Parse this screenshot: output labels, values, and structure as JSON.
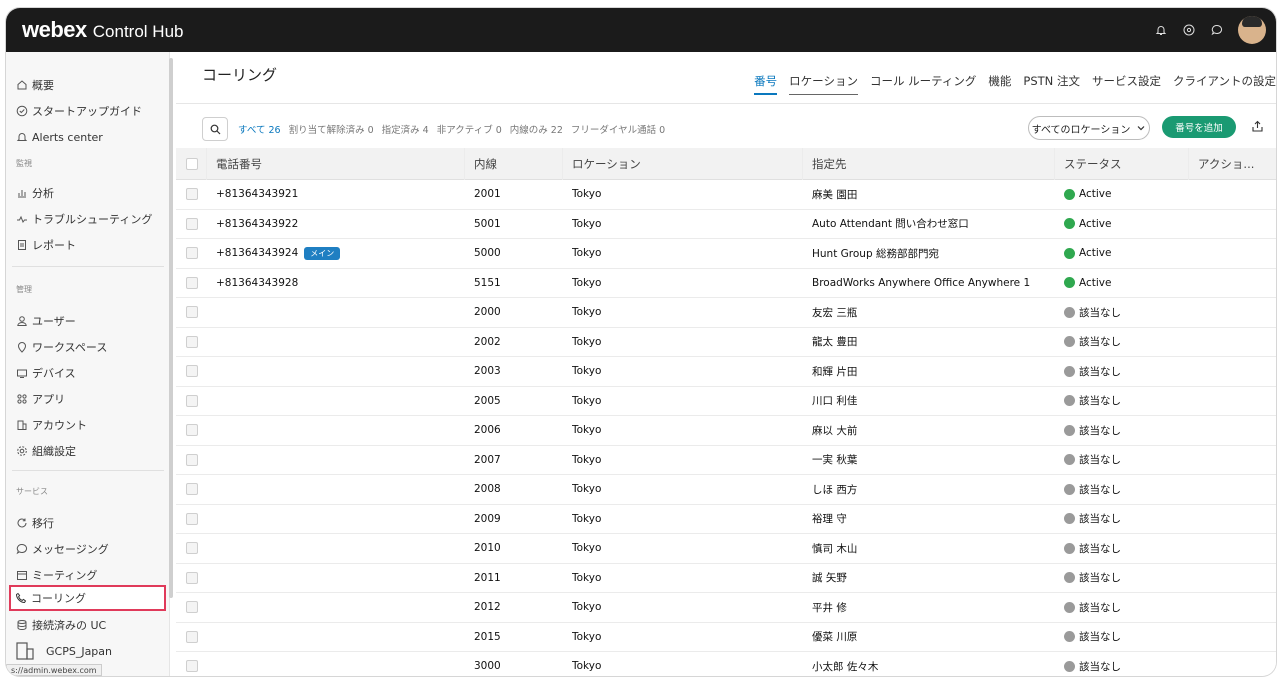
{
  "app": {
    "logo": "webex",
    "product": "Control Hub"
  },
  "sidebar": {
    "items_top": [
      {
        "label": "概要",
        "icon": "home-icon"
      },
      {
        "label": "スタートアップガイド",
        "icon": "check-circle-icon"
      },
      {
        "label": "Alerts center",
        "icon": "bell-icon"
      }
    ],
    "section_monitor": "監視",
    "items_monitor": [
      {
        "label": "分析",
        "icon": "bar-chart-icon"
      },
      {
        "label": "トラブルシューティング",
        "icon": "pulse-icon"
      },
      {
        "label": "レポート",
        "icon": "report-icon"
      }
    ],
    "section_manage": "管理",
    "items_manage": [
      {
        "label": "ユーザー",
        "icon": "user-icon"
      },
      {
        "label": "ワークスペース",
        "icon": "location-pin-icon"
      },
      {
        "label": "デバイス",
        "icon": "device-icon"
      },
      {
        "label": "アプリ",
        "icon": "apps-icon"
      },
      {
        "label": "アカウント",
        "icon": "building-icon"
      },
      {
        "label": "組織設定",
        "icon": "gear-icon"
      }
    ],
    "section_services": "サービス",
    "items_services": [
      {
        "label": "移行",
        "icon": "refresh-icon"
      },
      {
        "label": "メッセージング",
        "icon": "chat-icon"
      },
      {
        "label": "ミーティング",
        "icon": "calendar-icon"
      },
      {
        "label": "コーリング",
        "icon": "phone-icon"
      },
      {
        "label": "接続済みの UC",
        "icon": "database-icon"
      }
    ],
    "org_name": "GCPS_Japan",
    "status_url": "s://admin.webex.com"
  },
  "page": {
    "title": "コーリング",
    "tabs": [
      "番号",
      "ロケーション",
      "コール ルーティング",
      "機能",
      "PSTN 注文",
      "サービス設定",
      "クライアントの設定"
    ],
    "active_tab": "番号"
  },
  "filters": [
    {
      "label": "すべて 26",
      "active": true
    },
    {
      "label": "割り当て解除済み 0",
      "active": false
    },
    {
      "label": "指定済み 4",
      "active": false
    },
    {
      "label": "非アクティブ 0",
      "active": false
    },
    {
      "label": "内線のみ 22",
      "active": false
    },
    {
      "label": "フリーダイヤル通話 0",
      "active": false
    }
  ],
  "location_select": "すべてのロケーション",
  "add_button": "番号を追加",
  "table": {
    "headers": [
      "電話番号",
      "内線",
      "ロケーション",
      "指定先",
      "ステータス",
      "アクショ..."
    ],
    "rows": [
      {
        "phone": "+81364343921",
        "badge": "",
        "ext": "2001",
        "loc": "Tokyo",
        "assigned": "麻美 園田",
        "status": "Active",
        "state": "active"
      },
      {
        "phone": "+81364343922",
        "badge": "",
        "ext": "5001",
        "loc": "Tokyo",
        "assigned": "Auto Attendant 問い合わせ窓口",
        "status": "Active",
        "state": "active"
      },
      {
        "phone": "+81364343924",
        "badge": "メイン",
        "ext": "5000",
        "loc": "Tokyo",
        "assigned": "Hunt Group 総務部部門宛",
        "status": "Active",
        "state": "active"
      },
      {
        "phone": "+81364343928",
        "badge": "",
        "ext": "5151",
        "loc": "Tokyo",
        "assigned": "BroadWorks Anywhere Office Anywhere 1",
        "status": "Active",
        "state": "active"
      },
      {
        "phone": "",
        "badge": "",
        "ext": "2000",
        "loc": "Tokyo",
        "assigned": "友宏 三瓶",
        "status": "該当なし",
        "state": "na"
      },
      {
        "phone": "",
        "badge": "",
        "ext": "2002",
        "loc": "Tokyo",
        "assigned": "龍太 豊田",
        "status": "該当なし",
        "state": "na"
      },
      {
        "phone": "",
        "badge": "",
        "ext": "2003",
        "loc": "Tokyo",
        "assigned": "和輝 片田",
        "status": "該当なし",
        "state": "na"
      },
      {
        "phone": "",
        "badge": "",
        "ext": "2005",
        "loc": "Tokyo",
        "assigned": "川口 利佳",
        "status": "該当なし",
        "state": "na"
      },
      {
        "phone": "",
        "badge": "",
        "ext": "2006",
        "loc": "Tokyo",
        "assigned": "麻以 大前",
        "status": "該当なし",
        "state": "na"
      },
      {
        "phone": "",
        "badge": "",
        "ext": "2007",
        "loc": "Tokyo",
        "assigned": "一実 秋葉",
        "status": "該当なし",
        "state": "na"
      },
      {
        "phone": "",
        "badge": "",
        "ext": "2008",
        "loc": "Tokyo",
        "assigned": "しほ 西方",
        "status": "該当なし",
        "state": "na"
      },
      {
        "phone": "",
        "badge": "",
        "ext": "2009",
        "loc": "Tokyo",
        "assigned": "裕理 守",
        "status": "該当なし",
        "state": "na"
      },
      {
        "phone": "",
        "badge": "",
        "ext": "2010",
        "loc": "Tokyo",
        "assigned": "慎司 木山",
        "status": "該当なし",
        "state": "na"
      },
      {
        "phone": "",
        "badge": "",
        "ext": "2011",
        "loc": "Tokyo",
        "assigned": "誠 矢野",
        "status": "該当なし",
        "state": "na"
      },
      {
        "phone": "",
        "badge": "",
        "ext": "2012",
        "loc": "Tokyo",
        "assigned": "平井 修",
        "status": "該当なし",
        "state": "na"
      },
      {
        "phone": "",
        "badge": "",
        "ext": "2015",
        "loc": "Tokyo",
        "assigned": "優菜 川原",
        "status": "該当なし",
        "state": "na"
      },
      {
        "phone": "",
        "badge": "",
        "ext": "3000",
        "loc": "Tokyo",
        "assigned": "小太郎 佐々木",
        "status": "該当なし",
        "state": "na"
      }
    ]
  },
  "colors": {
    "accent": "#0a78be",
    "active_green": "#2fa84f",
    "inactive_gray": "#9a9a9a",
    "add_button": "#1a9a72",
    "topbar": "#1b1b1b",
    "highlight": "#e03a5a"
  }
}
